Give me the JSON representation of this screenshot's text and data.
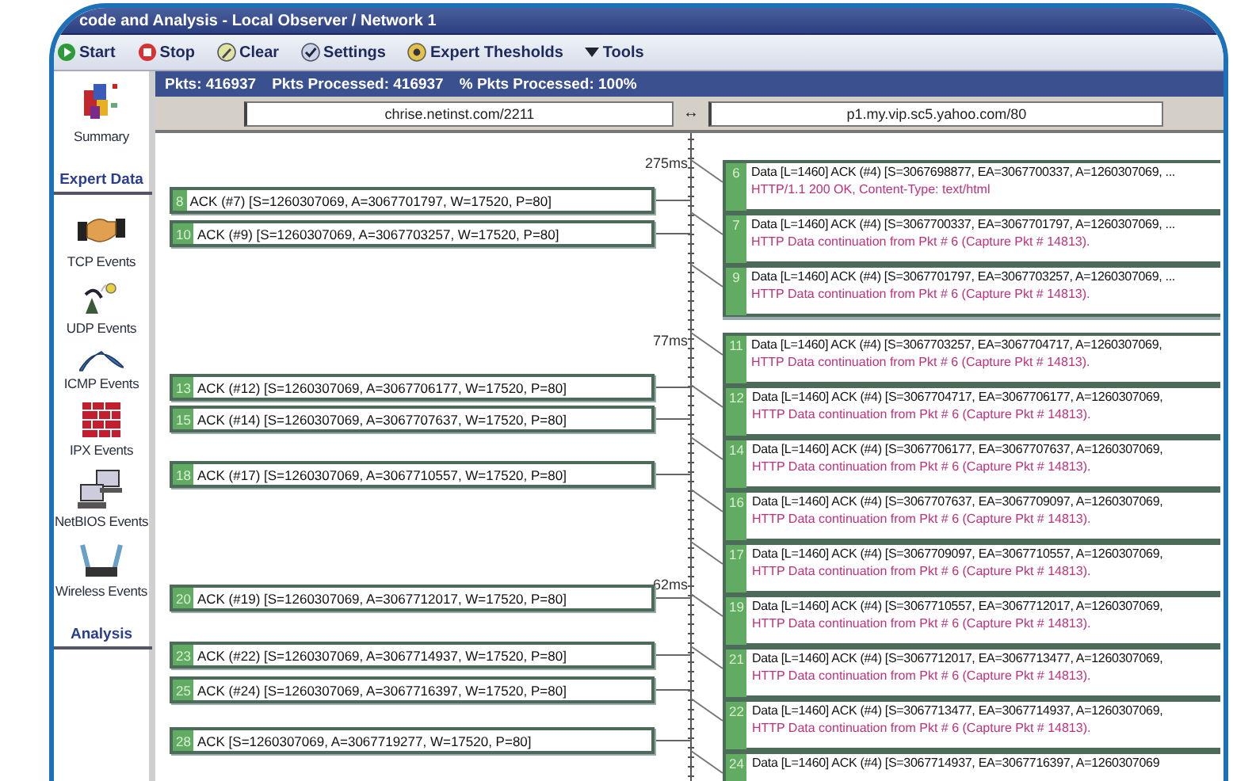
{
  "window": {
    "title": "code and Analysis - Local Observer / Network 1"
  },
  "toolbar": [
    {
      "label": "Start"
    },
    {
      "label": "Stop"
    },
    {
      "label": "Clear"
    },
    {
      "label": "Settings"
    },
    {
      "label": "Expert Thesholds"
    },
    {
      "label": "Tools"
    }
  ],
  "stats": [
    "Pkts: 416937",
    "Pkts Processed: 416937",
    "% Pkts Processed: 100%"
  ],
  "sidebar": {
    "items": [
      {
        "kind": "item",
        "label": "Summary"
      },
      {
        "kind": "header",
        "label": "Expert Data"
      },
      {
        "kind": "item",
        "label": "TCP Events"
      },
      {
        "kind": "item",
        "label": "UDP Events"
      },
      {
        "kind": "item",
        "label": "ICMP Events"
      },
      {
        "kind": "item",
        "label": "IPX Events"
      },
      {
        "kind": "item",
        "label": "NetBIOS Events"
      },
      {
        "kind": "item",
        "label": "Wireless Events"
      },
      {
        "kind": "header",
        "label": "Analysis"
      }
    ]
  },
  "endpoints": {
    "left": "chrise.netinst.com/2211",
    "separator": "↔",
    "right": "p1.my.vip.sc5.yahoo.com/80"
  },
  "timeline": {
    "markers": [
      "275ms",
      "77ms",
      "62ms"
    ],
    "left_packets": [
      {
        "number": "8",
        "summary": "ACK (#7) [S=1260307069, A=3067701797, W=17520, P=80]"
      },
      {
        "number": "10",
        "summary": "ACK (#9) [S=1260307069, A=3067703257, W=17520, P=80]"
      },
      {
        "number": "13",
        "summary": "ACK (#12) [S=1260307069, A=3067706177, W=17520, P=80]"
      },
      {
        "number": "15",
        "summary": "ACK (#14) [S=1260307069, A=3067707637, W=17520, P=80]"
      },
      {
        "number": "18",
        "summary": "ACK (#17) [S=1260307069, A=3067710557, W=17520, P=80]"
      },
      {
        "number": "20",
        "summary": "ACK (#19) [S=1260307069, A=3067712017, W=17520, P=80]"
      },
      {
        "number": "23",
        "summary": "ACK (#22) [S=1260307069, A=3067714937, W=17520, P=80]"
      },
      {
        "number": "25",
        "summary": "ACK (#24) [S=1260307069, A=3067716397, W=17520, P=80]"
      },
      {
        "number": "28",
        "summary": "ACK [S=1260307069, A=3067719277, W=17520, P=80]"
      }
    ],
    "right_packets": [
      {
        "number": "6",
        "summary": "Data [L=1460] ACK (#4) [S=3067698877, EA=3067700337, A=1260307069, ...",
        "note": "HTTP/1.1 200 OK, Content-Type: text/html"
      },
      {
        "number": "7",
        "summary": "Data [L=1460] ACK (#4) [S=3067700337, EA=3067701797, A=1260307069, ...",
        "note": "HTTP Data continuation from Pkt # 6 (Capture Pkt # 14813)."
      },
      {
        "number": "9",
        "summary": "Data [L=1460] ACK (#4) [S=3067701797, EA=3067703257, A=1260307069, ...",
        "note": "HTTP Data continuation from Pkt # 6 (Capture Pkt # 14813)."
      },
      {
        "number": "11",
        "summary": "Data [L=1460] ACK (#4) [S=3067703257, EA=3067704717, A=1260307069,",
        "note": "HTTP Data continuation from Pkt # 6 (Capture Pkt # 14813)."
      },
      {
        "number": "12",
        "summary": "Data [L=1460] ACK (#4) [S=3067704717, EA=3067706177, A=1260307069,",
        "note": "HTTP Data continuation from Pkt # 6 (Capture Pkt # 14813)."
      },
      {
        "number": "14",
        "summary": "Data [L=1460] ACK (#4) [S=3067706177, EA=3067707637, A=1260307069,",
        "note": "HTTP Data continuation from Pkt # 6 (Capture Pkt # 14813)."
      },
      {
        "number": "16",
        "summary": "Data [L=1460] ACK (#4) [S=3067707637, EA=3067709097, A=1260307069,",
        "note": "HTTP Data continuation from Pkt # 6 (Capture Pkt # 14813)."
      },
      {
        "number": "17",
        "summary": "Data [L=1460] ACK (#4) [S=3067709097, EA=3067710557, A=1260307069,",
        "note": "HTTP Data continuation from Pkt # 6 (Capture Pkt # 14813)."
      },
      {
        "number": "19",
        "summary": "Data [L=1460] ACK (#4) [S=3067710557, EA=3067712017, A=1260307069,",
        "note": "HTTP Data continuation from Pkt # 6 (Capture Pkt # 14813)."
      },
      {
        "number": "21",
        "summary": "Data [L=1460] ACK (#4) [S=3067712017, EA=3067713477, A=1260307069,",
        "note": "HTTP Data continuation from Pkt # 6 (Capture Pkt # 14813)."
      },
      {
        "number": "22",
        "summary": "Data [L=1460] ACK (#4) [S=3067713477, EA=3067714937, A=1260307069,",
        "note": "HTTP Data continuation from Pkt # 6 (Capture Pkt # 14813)."
      },
      {
        "number": "24",
        "summary": "Data [L=1460] ACK (#4) [S=3067714937, EA=3067716397, A=1260307069"
      }
    ]
  }
}
